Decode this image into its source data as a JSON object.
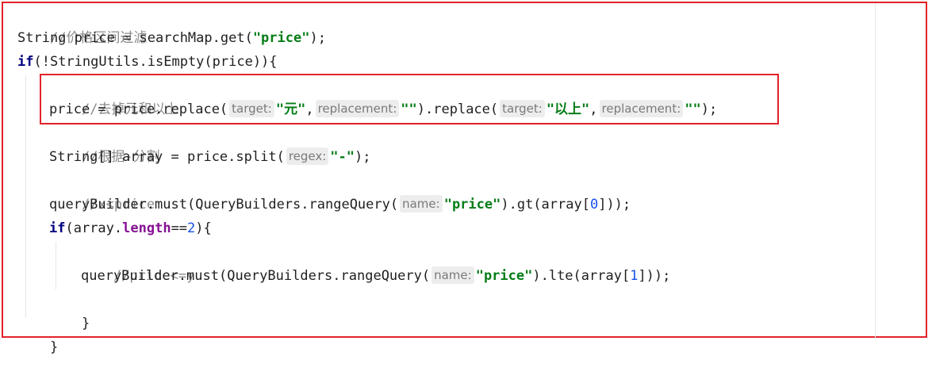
{
  "code": {
    "l1_comment": "//价格区间过滤",
    "l2_pre": "String price = searchMap.get(",
    "l2_str": "\"price\"",
    "l2_post": ");",
    "l3_kw": "if",
    "l3_rest": "(!StringUtils.isEmpty(price)){",
    "l4_comment": "//去掉元和以上",
    "l5_pre": "price = price.replace(",
    "l5_hint1": "target:",
    "l5_str1": "\"元\"",
    "l5_sep1": ",",
    "l5_hint2": "replacement:",
    "l5_str2": "\"\"",
    "l5_mid": ").replace(",
    "l5_hint3": "target:",
    "l5_str3": "\"以上\"",
    "l5_sep2": ",",
    "l5_hint4": "replacement:",
    "l5_str4": "\"\"",
    "l5_post": ");",
    "l6_comment": "//根据-分割",
    "l7_pre": "String[] array = price.split(",
    "l7_hint": "regex:",
    "l7_str": "\"-\"",
    "l7_post": ");",
    "l8_comment": "//x<price",
    "l9_pre": "queryBuilder.must(QueryBuilders.rangeQuery(",
    "l9_hint": "name:",
    "l9_str": "\"price\"",
    "l9_mid": ").gt(array[",
    "l9_num": "0",
    "l9_post": "]));",
    "l10_kw": "if",
    "l10_pre": "(array.",
    "l10_field": "length",
    "l10_op": "==",
    "l10_num": "2",
    "l10_post": "){",
    "l11_comment": "//price<=y",
    "l12_pre": "queryBuilder.must(QueryBuilders.rangeQuery(",
    "l12_hint": "name:",
    "l12_str": "\"price\"",
    "l12_mid": ").lte(array[",
    "l12_num": "1",
    "l12_post": "]));",
    "l13_close": "}",
    "l14_close": "}"
  },
  "colors": {
    "highlight_border": "#e2222a",
    "keyword": "#000080",
    "string": "#067d17",
    "number": "#1750eb",
    "comment": "#8c8c8c",
    "field": "#871094"
  }
}
